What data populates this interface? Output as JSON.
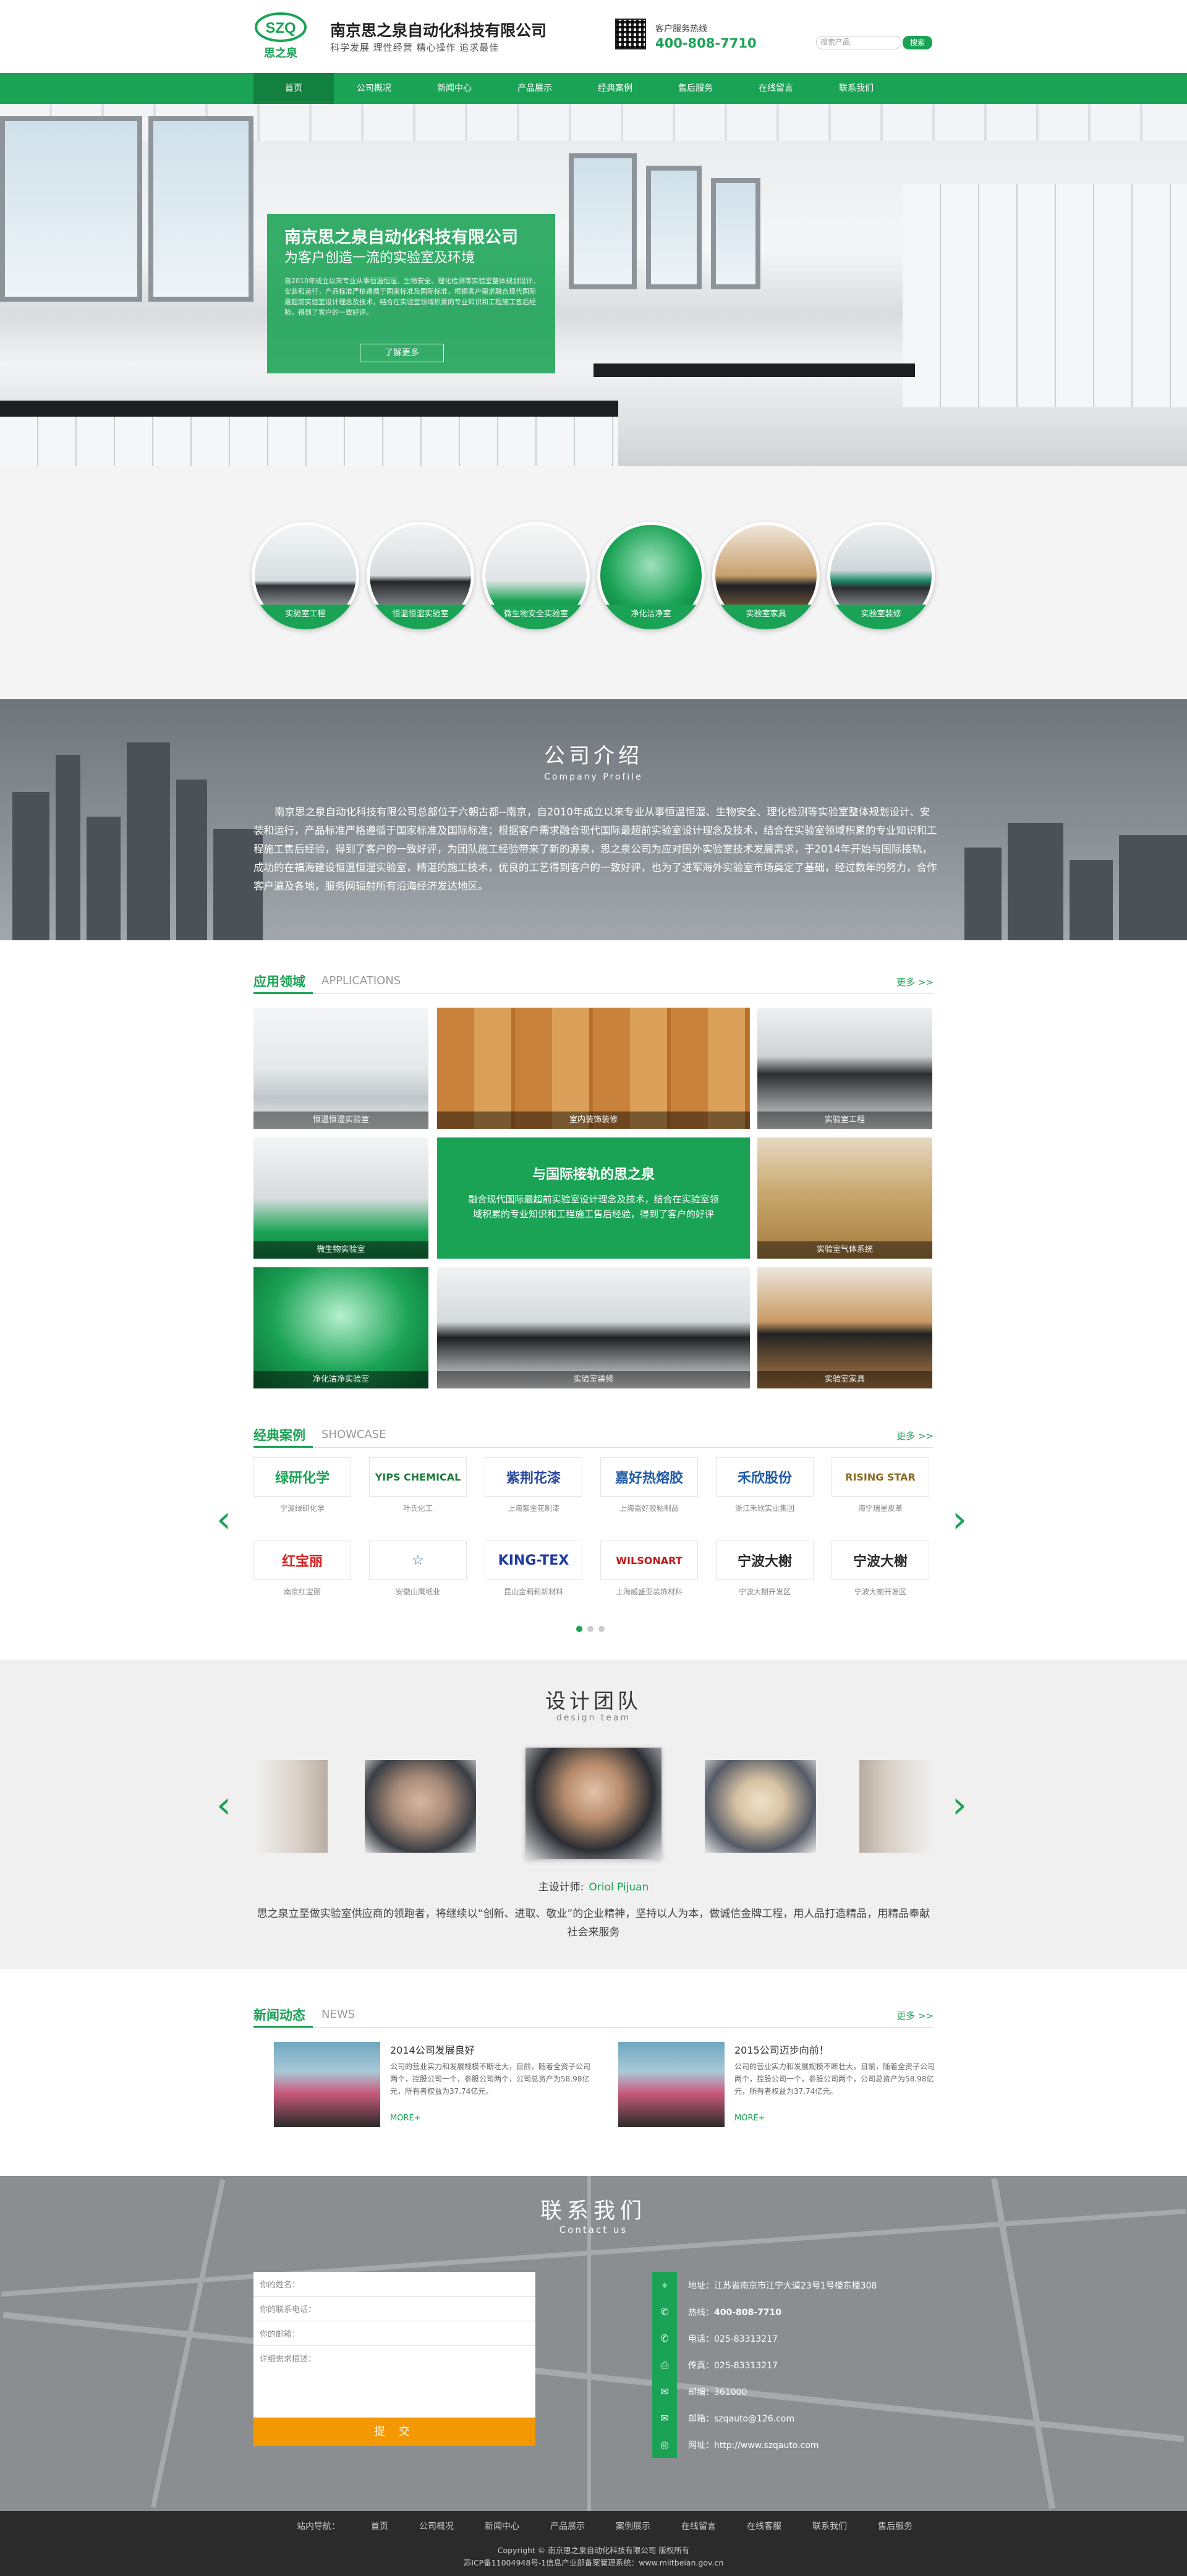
{
  "header": {
    "logo_letters": "SZQ",
    "logo_cn": "思之泉",
    "company_name": "南京思之泉自动化科技有限公司",
    "slogan": "科学发展 理性经营 精心操作 追求最佳",
    "hotline_label": "客户服务热线",
    "hotline_number": "400-808-7710",
    "search_placeholder": "搜索产品",
    "search_button": "搜索"
  },
  "nav": {
    "items": [
      "首页",
      "公司概况",
      "新闻中心",
      "产品展示",
      "经典案例",
      "售后服务",
      "在线留言",
      "联系我们"
    ]
  },
  "banner": {
    "title": "南京思之泉自动化科技有限公司",
    "subtitle": "为客户创造一流的实验室及环境",
    "text": "自2010年成立以来专业从事恒温恒湿、生物安全、理化检测等实验室整体规划设计、安装和运行，产品标准严格遵循于国家标准及国际标准，根据客户需求融合现代国际最超前实验室设计理念及技术，结合在实验室领域积累的专业知识和工程施工售后经验，得到了客户的一致好评。",
    "button": "了解更多"
  },
  "circles": [
    "实验室工程",
    "恒温恒湿实验室",
    "微生物安全实验室",
    "净化洁净室",
    "实验室家具",
    "实验室装修"
  ],
  "profile": {
    "title": "公司介绍",
    "subtitle": "Company Profile",
    "text": "南京思之泉自动化科技有限公司总部位于六朝古都--南京，自2010年成立以来专业从事恒温恒湿、生物安全、理化检测等实验室整体规划设计、安装和运行，产品标准严格遵循于国家标准及国际标准；根据客户需求融合现代国际最超前实验室设计理念及技术，结合在实验室领域积累的专业知识和工程施工售后经验，得到了客户的一致好评，为团队施工经验带来了新的源泉，思之泉公司为应对国外实验室技术发展需求，于2014年开始与国际接轨，成功的在福海建设恒温恒湿实验室，精湛的施工技术，优良的工艺得到客户的一致好评，也为了进军海外实验室市场奠定了基础，经过数年的努力，合作客户遍及各地，服务网辐射所有沿海经济发达地区。"
  },
  "applications": {
    "title_zh": "应用领域",
    "title_en": "APPLICATIONS",
    "more": "更多 >>",
    "tiles": [
      "恒温恒湿实验室",
      "室内装饰装修",
      "实验室工程",
      "微生物实验室",
      "实验室气体系统",
      "净化洁净实验室",
      "实验室装修",
      "实验室家具"
    ],
    "center_title": "与国际接轨的思之泉",
    "center_text": "融合现代国际最超前实验室设计理念及技术，结合在实验室领域积累的专业知识和工程施工售后经验，得到了客户的好评"
  },
  "showcase": {
    "title_zh": "经典案例",
    "title_en": "SHOWCASE",
    "more": "更多 >>",
    "cases": [
      {
        "logo": "绿研化学",
        "name": "宁波绿研化学",
        "color": "#1aa355"
      },
      {
        "logo": "YIPS CHEMICAL",
        "name": "叶氏化工",
        "color": "#1a7a3a"
      },
      {
        "logo": "紫荆花漆",
        "name": "上海紫金花制漆",
        "color": "#2a4aa0"
      },
      {
        "logo": "嘉好热熔胶",
        "name": "上海嘉好胶粘制品",
        "color": "#1e5aa8"
      },
      {
        "logo": "禾欣股份",
        "name": "浙江禾欣实业集团",
        "color": "#1e5aa8"
      },
      {
        "logo": "RISING STAR",
        "name": "海宁瑞星皮革",
        "color": "#8a6a20"
      },
      {
        "logo": "红宝丽",
        "name": "南京红宝丽",
        "color": "#d6201e"
      },
      {
        "logo": "☆",
        "name": "安徽山鹰纸业",
        "color": "#2a6ab0"
      },
      {
        "logo": "KING-TEX",
        "name": "昆山金莉莉新材料",
        "color": "#1e3aa0"
      },
      {
        "logo": "WILSONART",
        "name": "上海威盛亚装饰材料",
        "color": "#c01818"
      },
      {
        "logo": "宁波大榭",
        "name": "宁波大榭开发区",
        "color": "#2b2b2b"
      },
      {
        "logo": "宁波大榭",
        "name": "宁波大榭开发区",
        "color": "#2b2b2b"
      }
    ]
  },
  "team": {
    "title": "设计团队",
    "subtitle": "design team",
    "designer_label": "主设计师:",
    "designer_name": "Oriol Pijuan",
    "desc": "思之泉立至做实验室供应商的领跑者，将继续以“创新、进取、敬业”的企业精神，坚持以人为本，做诚信金牌工程，用人品打造精品，用精品奉献社会来服务"
  },
  "news": {
    "title_zh": "新闻动态",
    "title_en": "NEWS",
    "more": "更多 >>",
    "items": [
      {
        "title": "2014公司发展良好",
        "text": "公司的营业实力和发展规模不断壮大，目前，随着全资子公司两个，控股公司一个，参股公司两个，公司总资产为58.98亿元，所有者权益为37.74亿元。",
        "more": "MORE+"
      },
      {
        "title": "2015公司迈步向前！",
        "text": "公司的营业实力和发展规模不断壮大，目前，随着全资子公司两个，控股公司一个，参股公司两个，公司总资产为58.98亿元，所有者权益为37.74亿元。",
        "more": "MORE+"
      }
    ]
  },
  "contact": {
    "title": "联系我们",
    "subtitle": "Contact us",
    "form": {
      "name": "你的姓名：",
      "contact": "你的联系电话：",
      "email": "你的邮箱：",
      "detail": "详细需求描述：",
      "submit": "提 交"
    },
    "info": [
      {
        "icon": "location-icon",
        "glyph": "⌖",
        "label": "地址：",
        "value": "江苏省南京市江宁大道23号1号楼东楼308"
      },
      {
        "icon": "phone-icon",
        "glyph": "✆",
        "label": "热线：",
        "value": "400-808-7710"
      },
      {
        "icon": "phone-icon",
        "glyph": "✆",
        "label": "电话：",
        "value": "025-83313217"
      },
      {
        "icon": "fax-icon",
        "glyph": "⎙",
        "label": "传真：",
        "value": "025-83313217"
      },
      {
        "icon": "mail-icon",
        "glyph": "✉",
        "label": "邮编：",
        "value": "361000"
      },
      {
        "icon": "mail-icon",
        "glyph": "✉",
        "label": "邮箱：",
        "value": "szqauto@126.com"
      },
      {
        "icon": "globe-icon",
        "glyph": "◎",
        "label": "网址：",
        "value": "http://www.szqauto.com"
      }
    ]
  },
  "footer": {
    "links": [
      "站内导航：",
      "首页",
      "公司概况",
      "新闻中心",
      "产品展示",
      "案例展示",
      "在线留言",
      "在线客服",
      "联系我们",
      "售后服务"
    ],
    "copyright": "Copyright © 南京思之泉自动化科技有限公司 版权所有",
    "icp": "苏ICP备11004948号-1信息产业部备案管理系统：www.miitbeian.gov.cn"
  },
  "colors": {
    "brand": "#1aa355",
    "accent": "#f39800"
  }
}
